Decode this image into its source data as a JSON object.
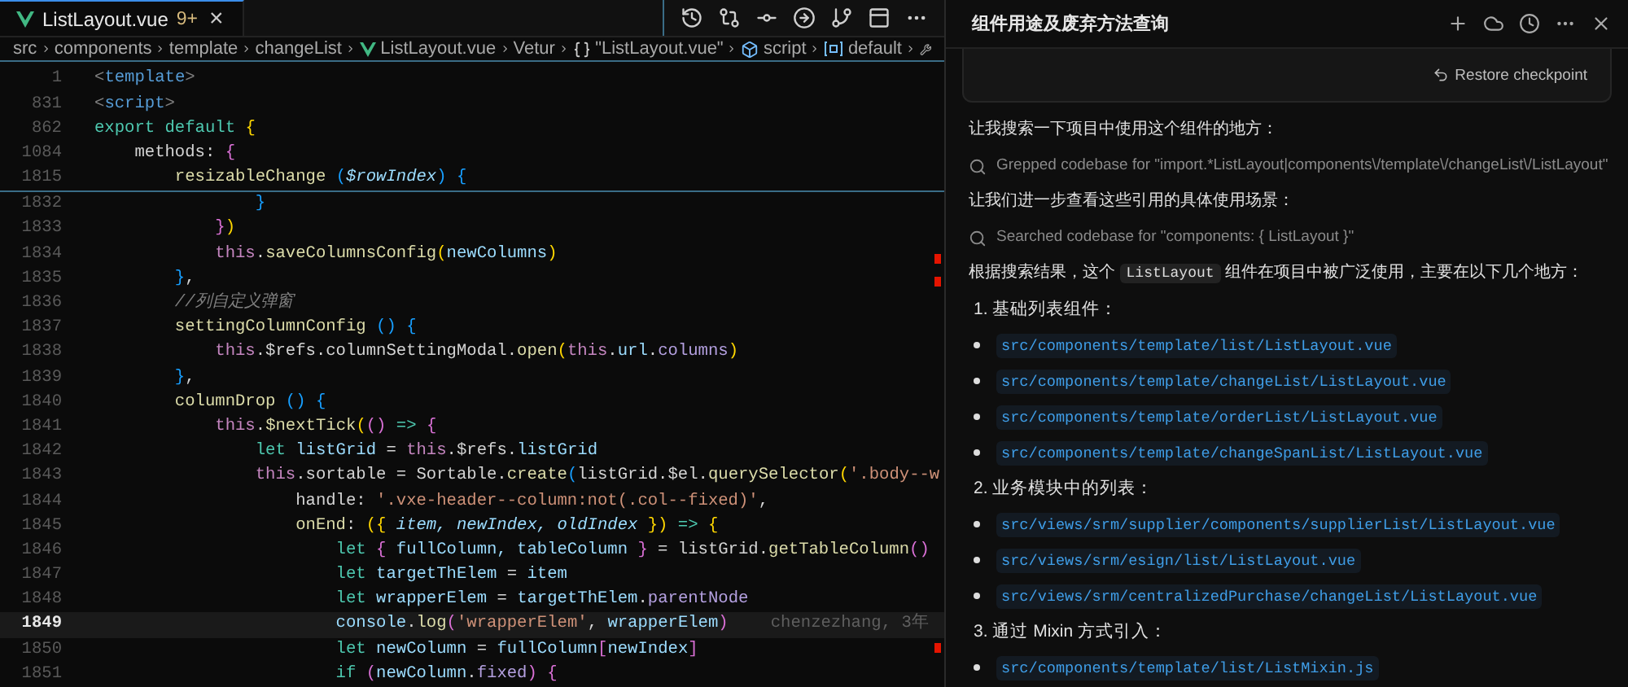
{
  "editor": {
    "tab": {
      "label": "ListLayout.vue",
      "badge": "9+",
      "close": "×",
      "selected": true
    },
    "breadcrumb": [
      {
        "kind": "folder",
        "label": "src"
      },
      {
        "kind": "folder",
        "label": "components"
      },
      {
        "kind": "folder",
        "label": "template"
      },
      {
        "kind": "folder",
        "label": "changeList"
      },
      {
        "kind": "vue",
        "label": "ListLayout.vue"
      },
      {
        "kind": "folder",
        "label": "Vetur"
      },
      {
        "kind": "object",
        "label": "\"ListLayout.vue\""
      },
      {
        "kind": "module",
        "label": "script"
      },
      {
        "kind": "variable",
        "label": "default"
      }
    ],
    "sticky_lines": [
      {
        "number": "1",
        "tokens": [
          {
            "kind": "punct",
            "text": "<"
          },
          {
            "kind": "tag",
            "text": "template"
          },
          {
            "kind": "punct",
            "text": ">"
          }
        ]
      },
      {
        "number": "831",
        "tokens": [
          {
            "kind": "punct",
            "text": "<"
          },
          {
            "kind": "tag",
            "text": "script"
          },
          {
            "kind": "punct",
            "text": ">"
          }
        ]
      },
      {
        "number": "862",
        "tokens": [
          {
            "kind": "kw",
            "text": "export default "
          },
          {
            "kind": "br1",
            "text": "{"
          }
        ]
      },
      {
        "number": "1084",
        "tokens": [
          {
            "kind": "plain",
            "text": "    methods: "
          },
          {
            "kind": "br2",
            "text": "{"
          }
        ]
      },
      {
        "number": "1815",
        "tokens": [
          {
            "kind": "fn",
            "text": "        resizableChange "
          },
          {
            "kind": "br3",
            "text": "("
          },
          {
            "kind": "param",
            "text": "$rowIndex"
          },
          {
            "kind": "br3",
            "text": ")"
          },
          {
            "kind": "br3",
            "text": " {"
          }
        ]
      }
    ],
    "lines": [
      {
        "number": "1832",
        "current": false,
        "tokens": [
          {
            "kind": "br3",
            "text": "                }"
          }
        ]
      },
      {
        "number": "1833",
        "current": false,
        "tokens": [
          {
            "kind": "br2",
            "text": "            }"
          },
          {
            "kind": "br1",
            "text": ")"
          }
        ]
      },
      {
        "number": "1834",
        "current": false,
        "tokens": [
          {
            "kind": "this",
            "text": "            this"
          },
          {
            "kind": "plain",
            "text": "."
          },
          {
            "kind": "fn",
            "text": "saveColumnsConfig"
          },
          {
            "kind": "br1",
            "text": "("
          },
          {
            "kind": "var",
            "text": "newColumns"
          },
          {
            "kind": "br1",
            "text": ")"
          }
        ]
      },
      {
        "number": "1835",
        "current": false,
        "tokens": [
          {
            "kind": "br3",
            "text": "        }"
          },
          {
            "kind": "plain",
            "text": ","
          }
        ]
      },
      {
        "number": "1836",
        "current": false,
        "tokens": [
          {
            "kind": "cmt",
            "text": "        //列自定义弹窗"
          }
        ]
      },
      {
        "number": "1837",
        "current": false,
        "tokens": [
          {
            "kind": "fn",
            "text": "        settingColumnConfig "
          },
          {
            "kind": "br3",
            "text": "()"
          },
          {
            "kind": "br3",
            "text": " {"
          }
        ]
      },
      {
        "number": "1838",
        "current": false,
        "tokens": [
          {
            "kind": "this",
            "text": "            this"
          },
          {
            "kind": "plain",
            "text": ".$refs.columnSettingModal."
          },
          {
            "kind": "fn",
            "text": "open"
          },
          {
            "kind": "br1",
            "text": "("
          },
          {
            "kind": "this",
            "text": "this"
          },
          {
            "kind": "plain",
            "text": "."
          },
          {
            "kind": "var",
            "text": "url"
          },
          {
            "kind": "plain",
            "text": "."
          },
          {
            "kind": "prop",
            "text": "columns"
          },
          {
            "kind": "br1",
            "text": ")"
          }
        ]
      },
      {
        "number": "1839",
        "current": false,
        "tokens": [
          {
            "kind": "br3",
            "text": "        }"
          },
          {
            "kind": "plain",
            "text": ","
          }
        ]
      },
      {
        "number": "1840",
        "current": false,
        "tokens": [
          {
            "kind": "fn",
            "text": "        columnDrop "
          },
          {
            "kind": "br3",
            "text": "()"
          },
          {
            "kind": "br3",
            "text": " {"
          }
        ]
      },
      {
        "number": "1841",
        "current": false,
        "tokens": [
          {
            "kind": "this",
            "text": "            this"
          },
          {
            "kind": "plain",
            "text": "."
          },
          {
            "kind": "fn",
            "text": "$nextTick"
          },
          {
            "kind": "br1",
            "text": "("
          },
          {
            "kind": "br2",
            "text": "()"
          },
          {
            "kind": "kw",
            "text": " => "
          },
          {
            "kind": "br2",
            "text": "{"
          }
        ]
      },
      {
        "number": "1842",
        "current": false,
        "tokens": [
          {
            "kind": "kw",
            "text": "                let "
          },
          {
            "kind": "var",
            "text": "listGrid"
          },
          {
            "kind": "plain",
            "text": " = "
          },
          {
            "kind": "this",
            "text": "this"
          },
          {
            "kind": "plain",
            "text": ".$refs."
          },
          {
            "kind": "var",
            "text": "listGrid"
          }
        ]
      },
      {
        "number": "1843",
        "current": false,
        "tokens": [
          {
            "kind": "this",
            "text": "                this"
          },
          {
            "kind": "plain",
            "text": ".sortable = Sortable."
          },
          {
            "kind": "fn",
            "text": "create"
          },
          {
            "kind": "br3",
            "text": "("
          },
          {
            "kind": "plain",
            "text": "listGrid.$el."
          },
          {
            "kind": "fn",
            "text": "querySelector"
          },
          {
            "kind": "br1",
            "text": "("
          },
          {
            "kind": "str",
            "text": "'.body--w"
          }
        ]
      },
      {
        "number": "1844",
        "current": false,
        "tokens": [
          {
            "kind": "plain",
            "text": "                    handle: "
          },
          {
            "kind": "str",
            "text": "'.vxe-header--column:not(.col--fixed)'"
          },
          {
            "kind": "plain",
            "text": ","
          }
        ]
      },
      {
        "number": "1845",
        "current": false,
        "tokens": [
          {
            "kind": "fn",
            "text": "                    onEnd"
          },
          {
            "kind": "plain",
            "text": ": "
          },
          {
            "kind": "br1",
            "text": "({ "
          },
          {
            "kind": "param",
            "text": "item, newIndex, oldIndex"
          },
          {
            "kind": "br1",
            "text": " })"
          },
          {
            "kind": "kw",
            "text": " => "
          },
          {
            "kind": "br1",
            "text": "{"
          }
        ]
      },
      {
        "number": "1846",
        "current": false,
        "tokens": [
          {
            "kind": "kw",
            "text": "                        let "
          },
          {
            "kind": "br2",
            "text": "{ "
          },
          {
            "kind": "var",
            "text": "fullColumn, tableColumn"
          },
          {
            "kind": "br2",
            "text": " }"
          },
          {
            "kind": "plain",
            "text": " = listGrid."
          },
          {
            "kind": "fn",
            "text": "getTableColumn"
          },
          {
            "kind": "br2",
            "text": "()"
          }
        ]
      },
      {
        "number": "1847",
        "current": false,
        "tokens": [
          {
            "kind": "kw",
            "text": "                        let "
          },
          {
            "kind": "var",
            "text": "targetThElem"
          },
          {
            "kind": "plain",
            "text": " = "
          },
          {
            "kind": "var",
            "text": "item"
          }
        ]
      },
      {
        "number": "1848",
        "current": false,
        "tokens": [
          {
            "kind": "kw",
            "text": "                        let "
          },
          {
            "kind": "var",
            "text": "wrapperElem"
          },
          {
            "kind": "plain",
            "text": " = "
          },
          {
            "kind": "var",
            "text": "targetThElem"
          },
          {
            "kind": "plain",
            "text": "."
          },
          {
            "kind": "prop",
            "text": "parentNode"
          }
        ]
      },
      {
        "number": "1849",
        "current": true,
        "tokens": [
          {
            "kind": "var",
            "text": "                        console"
          },
          {
            "kind": "plain",
            "text": "."
          },
          {
            "kind": "fn",
            "text": "log"
          },
          {
            "kind": "br2",
            "text": "("
          },
          {
            "kind": "str",
            "text": "'wrapperElem'"
          },
          {
            "kind": "plain",
            "text": ", "
          },
          {
            "kind": "var",
            "text": "wrapperElem"
          },
          {
            "kind": "br2",
            "text": ")"
          },
          {
            "kind": "blame",
            "text": "chenzezhang, 3年"
          }
        ]
      },
      {
        "number": "1850",
        "current": false,
        "tokens": [
          {
            "kind": "kw",
            "text": "                        let "
          },
          {
            "kind": "var",
            "text": "newColumn"
          },
          {
            "kind": "plain",
            "text": " = "
          },
          {
            "kind": "var",
            "text": "fullColumn"
          },
          {
            "kind": "br2",
            "text": "["
          },
          {
            "kind": "var",
            "text": "newIndex"
          },
          {
            "kind": "br2",
            "text": "]"
          }
        ]
      },
      {
        "number": "1851",
        "current": false,
        "tokens": [
          {
            "kind": "kw",
            "text": "                        if "
          },
          {
            "kind": "br2",
            "text": "("
          },
          {
            "kind": "var",
            "text": "newColumn"
          },
          {
            "kind": "plain",
            "text": "."
          },
          {
            "kind": "prop",
            "text": "fixed"
          },
          {
            "kind": "br2",
            "text": ")"
          },
          {
            "kind": "br2",
            "text": " {"
          }
        ]
      }
    ]
  },
  "chat": {
    "title": "组件用途及废弃方法查询",
    "restore_button": "Restore checkpoint",
    "messages": [
      {
        "kind": "text",
        "parts": [
          {
            "text": "让我搜索一下项目中使用这个组件的地方：",
            "code": false
          }
        ]
      },
      {
        "kind": "search",
        "text": "Grepped codebase for \"import.*ListLayout|components\\/template\\/changeList\\/ListLayout\""
      },
      {
        "kind": "text",
        "parts": [
          {
            "text": "让我们进一步查看这些引用的具体使用场景：",
            "code": false
          }
        ]
      },
      {
        "kind": "search",
        "text": "Searched codebase for \"components: { ListLayout }\""
      },
      {
        "kind": "text",
        "parts": [
          {
            "text": "根据搜索结果，这个 ",
            "code": false
          },
          {
            "text": "ListLayout",
            "code": true
          },
          {
            "text": " 组件在项目中被广泛使用，主要在以下几个地方：",
            "code": false
          }
        ]
      },
      {
        "kind": "heading",
        "text": "1. 基础列表组件："
      },
      {
        "kind": "bullet",
        "text": "src/components/template/list/ListLayout.vue"
      },
      {
        "kind": "bullet",
        "text": "src/components/template/changeList/ListLayout.vue"
      },
      {
        "kind": "bullet",
        "text": "src/components/template/orderList/ListLayout.vue"
      },
      {
        "kind": "bullet",
        "text": "src/components/template/changeSpanList/ListLayout.vue"
      },
      {
        "kind": "heading",
        "text": "2. 业务模块中的列表："
      },
      {
        "kind": "bullet",
        "text": "src/views/srm/supplier/components/supplierList/ListLayout.vue"
      },
      {
        "kind": "bullet",
        "text": "src/views/srm/esign/list/ListLayout.vue"
      },
      {
        "kind": "bullet",
        "text": "src/views/srm/centralizedPurchase/changeList/ListLayout.vue"
      },
      {
        "kind": "heading",
        "text": "3. 通过 Mixin 方式引入："
      },
      {
        "kind": "bullet",
        "text": "src/components/template/list/ListMixin.js"
      }
    ]
  }
}
